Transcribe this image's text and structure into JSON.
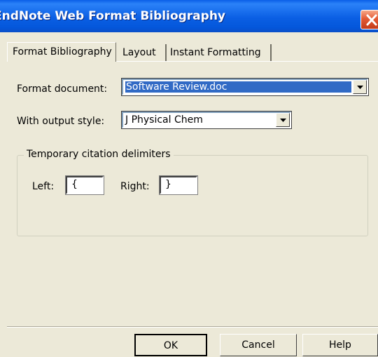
{
  "window": {
    "title": "EndNote Web Format Bibliography",
    "close_icon": "close-x-icon"
  },
  "tabs": [
    {
      "label": "Format Bibliography",
      "active": true
    },
    {
      "label": "Layout",
      "active": false
    },
    {
      "label": "Instant Formatting",
      "active": false
    }
  ],
  "form": {
    "format_document_label": "Format document:",
    "format_document_value": "Software Review.doc",
    "output_style_label": "With output style:",
    "output_style_value": "J Physical Chem",
    "delimiters_group_title": "Temporary citation delimiters",
    "left_label": "Left:",
    "left_value": "{",
    "right_label": "Right:",
    "right_value": "}"
  },
  "buttons": {
    "ok": "OK",
    "cancel": "Cancel",
    "help": "Help"
  },
  "colors": {
    "titlebar": "#0b5fe4",
    "dialog_bg": "#ece9d8",
    "selection": "#316ac5",
    "close_button": "#e35a35"
  }
}
